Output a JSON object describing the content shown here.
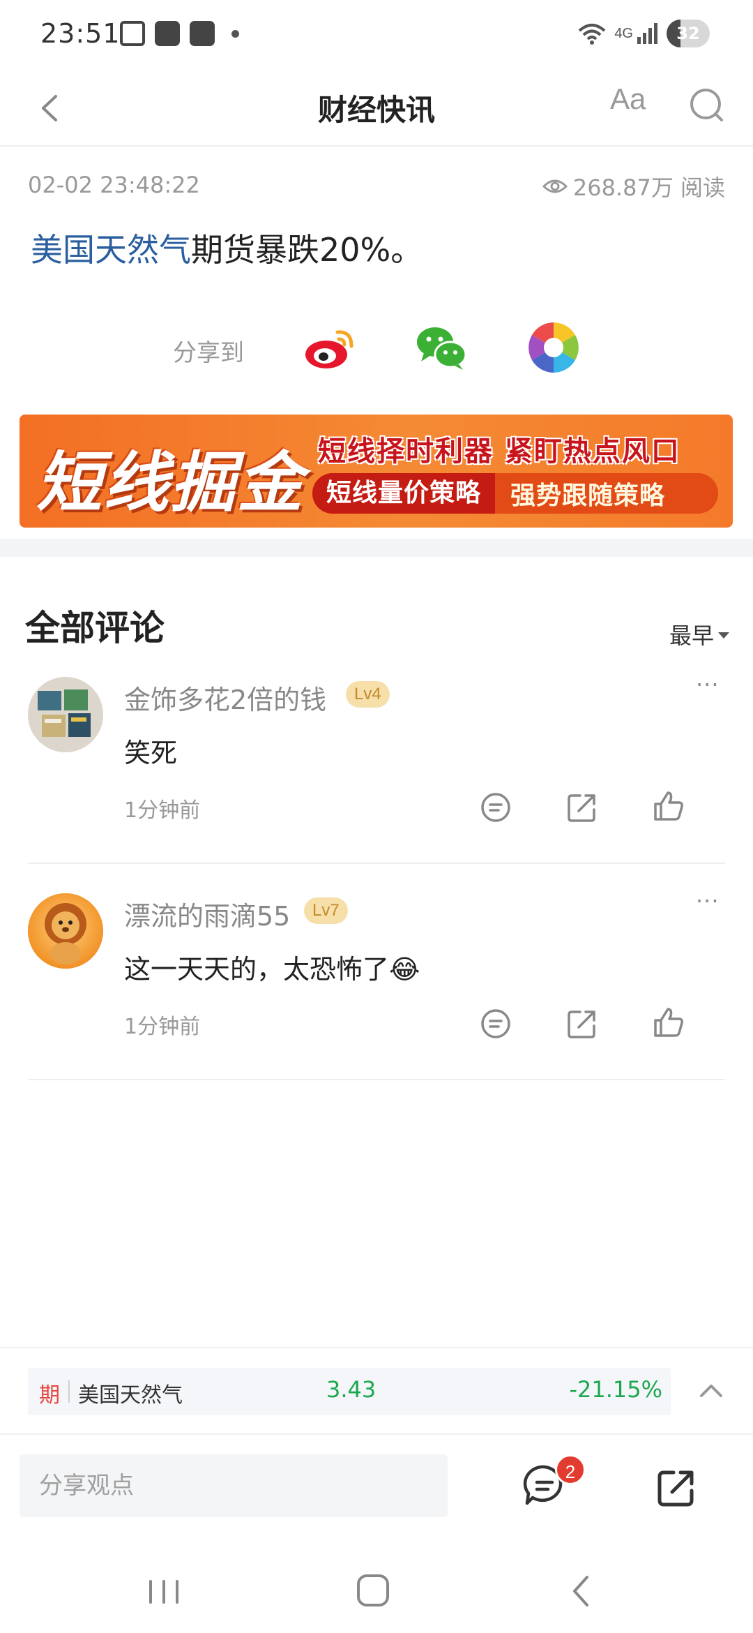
{
  "status_bar": {
    "time": "23:51",
    "battery_level": "32",
    "network": "4G"
  },
  "header": {
    "title": "财经快讯",
    "font_button": "Aa"
  },
  "article": {
    "timestamp": "02-02 23:48:22",
    "views": "268.87万 阅读",
    "headline_link": "美国天然气",
    "headline_rest": "期货暴跌20%。"
  },
  "share": {
    "label": "分享到",
    "targets": [
      "weibo-icon",
      "wechat-icon",
      "moments-icon"
    ]
  },
  "banner": {
    "main": "短线掘金",
    "tagline": "短线择时利器  紧盯热点风口",
    "tag_a": "短线量价策略",
    "tag_b": "强势跟随策略"
  },
  "comments": {
    "title": "全部评论",
    "sort": "最早",
    "items": [
      {
        "user": "金饰多花2倍的钱",
        "level": "Lv4",
        "text": "笑死",
        "time": "1分钟前"
      },
      {
        "user": "漂流的雨滴55",
        "level": "Lv7",
        "text": "这一天天的，太恐怖了",
        "emoji": "😂",
        "time": "1分钟前"
      }
    ]
  },
  "ticker": {
    "type": "期",
    "name": "美国天然气",
    "price": "3.43",
    "change": "-21.15%",
    "color_down": "#1aa84e"
  },
  "bottom_bar": {
    "input_placeholder": "分享观点",
    "comment_count": "2"
  },
  "colors": {
    "link": "#2a5e9e",
    "banner": "#f36f24",
    "badge": "#e23b30",
    "level_bg": "#f7dfa9"
  }
}
